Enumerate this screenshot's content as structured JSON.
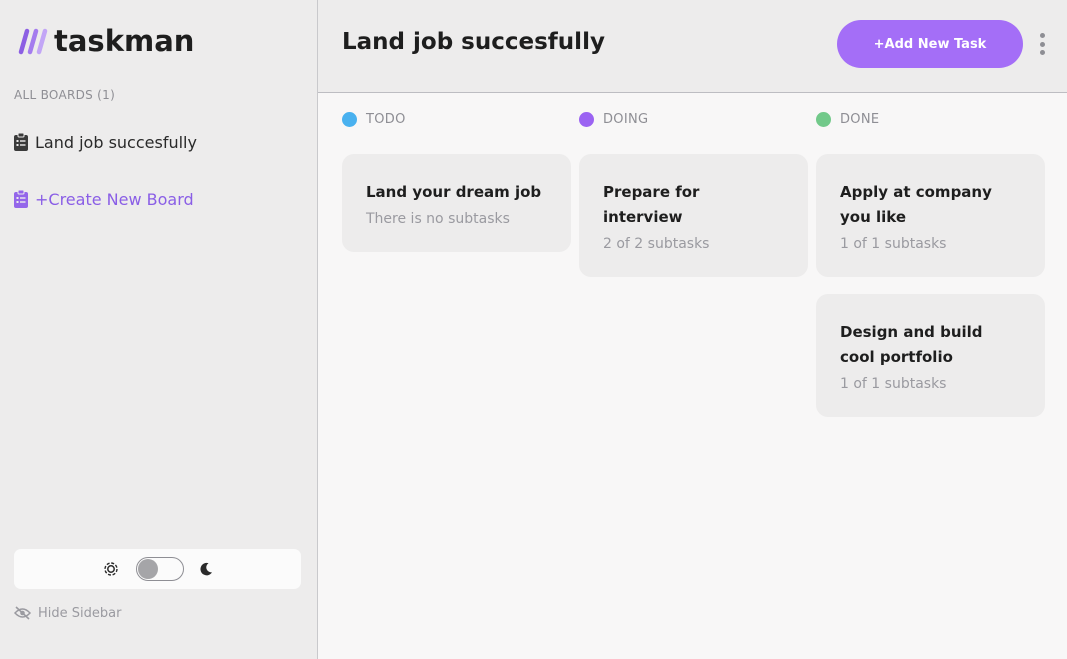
{
  "app": {
    "name": "taskman",
    "accent": "#a46ef7"
  },
  "sidebar": {
    "heading": "ALL BOARDS (1)",
    "boards": [
      {
        "label": "Land job succesfully"
      }
    ],
    "create_label": "+Create New Board",
    "hide_label": "Hide Sidebar"
  },
  "header": {
    "title": "Land job succesfully",
    "add_task_label": "+Add New Task"
  },
  "columns": [
    {
      "name": "TODO",
      "color": "#49b1ef",
      "cards": [
        {
          "title": "Land your dream job",
          "subtitle": "There is no subtasks"
        }
      ]
    },
    {
      "name": "DOING",
      "color": "#9b63f2",
      "cards": [
        {
          "title": "Prepare for interview",
          "subtitle": "2 of 2 subtasks"
        }
      ]
    },
    {
      "name": "DONE",
      "color": "#72c98a",
      "cards": [
        {
          "title": "Apply at company you like",
          "subtitle": "1 of 1 subtasks"
        },
        {
          "title": "Design and build cool portfolio",
          "subtitle": "1 of 1 subtasks"
        }
      ]
    }
  ],
  "icons": [
    "logo-icon",
    "board-icon",
    "sun-icon",
    "moon-icon",
    "eye-slash-icon",
    "more-vertical-icon"
  ]
}
